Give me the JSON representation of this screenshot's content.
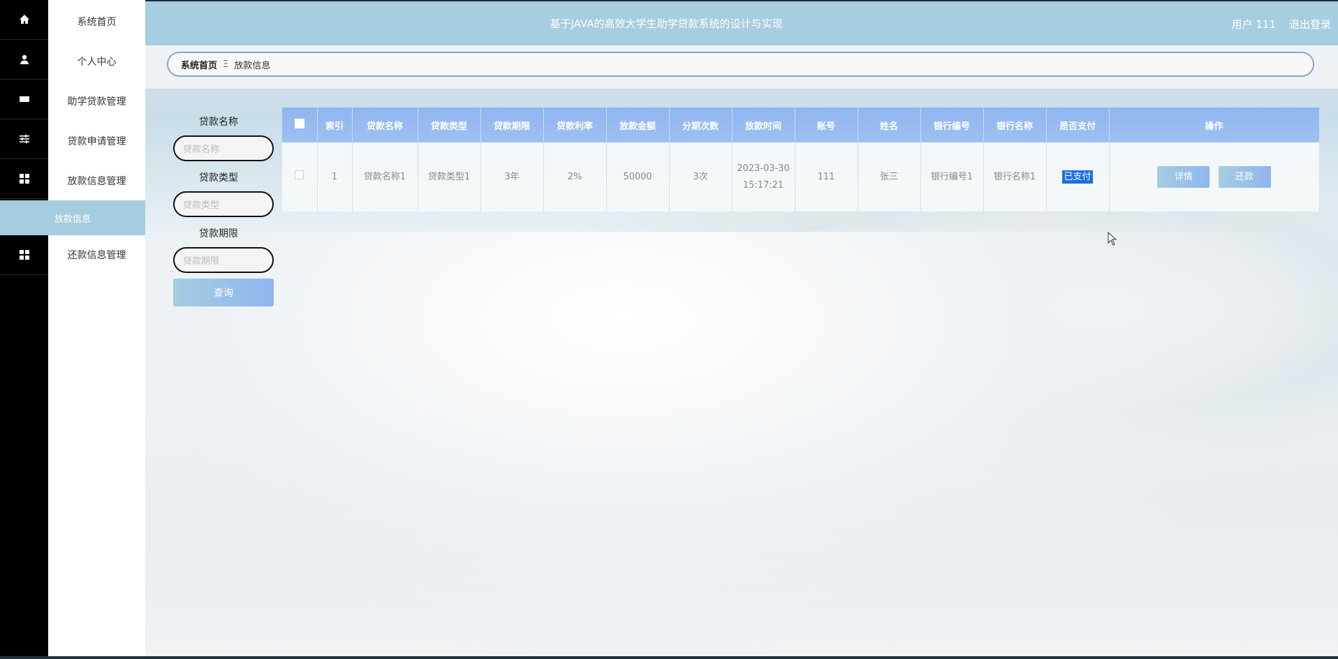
{
  "header": {
    "title": "基于JAVA的高效大学生助学贷款系统的设计与实现",
    "user": "用户 111",
    "logout": "退出登录"
  },
  "sidebar": {
    "items": [
      {
        "label": "系统首页",
        "icon": "home-icon"
      },
      {
        "label": "个人中心",
        "icon": "user-icon"
      },
      {
        "label": "助学贷款管理",
        "icon": "ticket-icon"
      },
      {
        "label": "贷款申请管理",
        "icon": "sliders-icon"
      },
      {
        "label": "放款信息管理",
        "icon": "grid-icon"
      },
      {
        "label": "还款信息管理",
        "icon": "grid-icon"
      }
    ],
    "active_sub": "放款信息"
  },
  "breadcrumb": {
    "home": "系统首页",
    "separator": "Ξ",
    "current": "放款信息"
  },
  "search": {
    "fields": [
      {
        "label": "贷款名称",
        "placeholder": "贷款名称"
      },
      {
        "label": "贷款类型",
        "placeholder": "贷款类型"
      },
      {
        "label": "贷款期限",
        "placeholder": "贷款期限"
      }
    ],
    "button": "查询"
  },
  "table": {
    "headers": [
      "索引",
      "贷款名称",
      "贷款类型",
      "贷款期限",
      "贷款利率",
      "放款金额",
      "分期次数",
      "放款时间",
      "账号",
      "姓名",
      "银行编号",
      "银行名称",
      "是否支付",
      "操作"
    ],
    "rows": [
      {
        "index": "1",
        "loan_name": "贷款名称1",
        "loan_type": "贷款类型1",
        "term": "3年",
        "rate": "2%",
        "amount": "50000",
        "installments": "3次",
        "time": "2023-03-30 15:17:21",
        "account": "111",
        "name": "张三",
        "bank_no": "银行编号1",
        "bank_name": "银行名称1",
        "paid": "已支付",
        "actions": [
          "详情",
          "还款"
        ]
      }
    ]
  },
  "colors": {
    "accent": "#a6cde0",
    "header_blue": "#8fb5f0",
    "paid_highlight": "#1e6fe0"
  }
}
